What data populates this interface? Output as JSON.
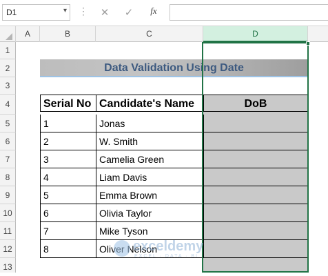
{
  "formula_bar": {
    "name_box": "D1",
    "cancel_icon": "✕",
    "enter_icon": "✓",
    "fx_label": "fx",
    "formula": ""
  },
  "columns": [
    "A",
    "B",
    "C",
    "D"
  ],
  "selected_column": "D",
  "rows": [
    "1",
    "2",
    "3",
    "4",
    "5",
    "6",
    "7",
    "8",
    "9",
    "10",
    "11",
    "12",
    "13"
  ],
  "sheet": {
    "title": "Data Validation Using Date",
    "table": {
      "headers": [
        "Serial No",
        "Candidate's Name",
        "DoB"
      ],
      "rows": [
        {
          "serial": "1",
          "name": "Jonas",
          "dob": ""
        },
        {
          "serial": "2",
          "name": "W. Smith",
          "dob": ""
        },
        {
          "serial": "3",
          "name": "Camelia Green",
          "dob": ""
        },
        {
          "serial": "4",
          "name": "Liam Davis",
          "dob": ""
        },
        {
          "serial": "5",
          "name": "Emma Brown",
          "dob": ""
        },
        {
          "serial": "6",
          "name": "Olivia Taylor",
          "dob": ""
        },
        {
          "serial": "7",
          "name": "Mike Tyson",
          "dob": ""
        },
        {
          "serial": "8",
          "name": "Oliver Nelson",
          "dob": ""
        }
      ]
    }
  },
  "watermark": {
    "text": "exceldemy",
    "sub": "EXCEL · DATA · BI"
  },
  "colors": {
    "accent": "#217346",
    "title_text": "#3d5a80",
    "header_fill": "#c9c9c9"
  }
}
